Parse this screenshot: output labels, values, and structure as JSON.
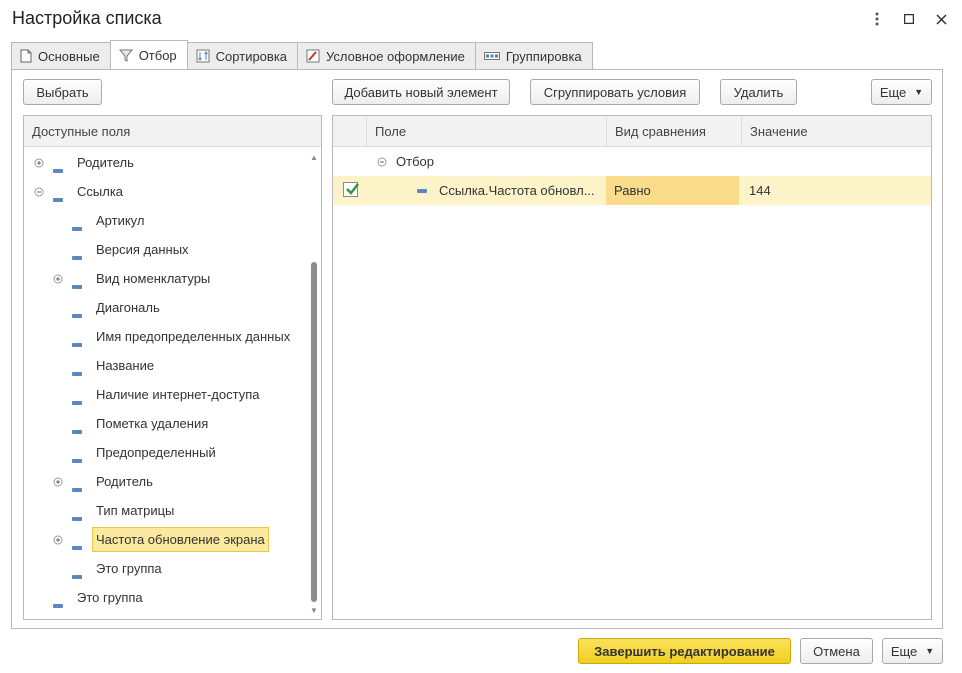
{
  "window": {
    "title": "Настройка списка"
  },
  "tabs": [
    {
      "label": "Основные",
      "icon": "document-icon"
    },
    {
      "label": "Отбор",
      "icon": "filter-icon",
      "active": true
    },
    {
      "label": "Сортировка",
      "icon": "sort-icon"
    },
    {
      "label": "Условное оформление",
      "icon": "paint-icon"
    },
    {
      "label": "Группировка",
      "icon": "grouping-icon"
    }
  ],
  "left": {
    "select_button": "Выбрать",
    "header": "Доступные поля",
    "items": [
      {
        "label": "Родитель",
        "level": 0,
        "expandable": true
      },
      {
        "label": "Ссылка",
        "level": 0,
        "expanded": true
      },
      {
        "label": "Артикул",
        "level": 1
      },
      {
        "label": "Версия данных",
        "level": 1
      },
      {
        "label": "Вид номенклатуры",
        "level": 1,
        "expandable": true
      },
      {
        "label": "Диагональ",
        "level": 1
      },
      {
        "label": "Имя предопределенных данных",
        "level": 1
      },
      {
        "label": "Название",
        "level": 1
      },
      {
        "label": "Наличие интернет-доступа",
        "level": 1
      },
      {
        "label": "Пометка удаления",
        "level": 1
      },
      {
        "label": "Предопределенный",
        "level": 1
      },
      {
        "label": "Родитель",
        "level": 1,
        "expandable": true
      },
      {
        "label": "Тип матрицы",
        "level": 1
      },
      {
        "label": "Частота обновление экрана",
        "level": 1,
        "expandable": true,
        "selected": true
      },
      {
        "label": "Это группа",
        "level": 1
      },
      {
        "label": "Это группа",
        "level": 0
      }
    ]
  },
  "right": {
    "toolbar": {
      "add": "Добавить новый элемент",
      "group": "Сгруппировать условия",
      "delete": "Удалить",
      "more": "Еще"
    },
    "columns": {
      "field": "Поле",
      "comparison": "Вид сравнения",
      "value": "Значение"
    },
    "group_row": {
      "label": "Отбор"
    },
    "rows": [
      {
        "checked": true,
        "field": "Ссылка.Частота обновл...",
        "comparison": "Равно",
        "value": "144"
      }
    ]
  },
  "footer": {
    "finish": "Завершить редактирование",
    "cancel": "Отмена",
    "more": "Еще"
  },
  "colors": {
    "accent_yellow": "#f1cf1f",
    "highlight_row": "#fdf3c8",
    "selected_cell": "#f8dc8a",
    "checkbox_green": "#2e9a3e"
  }
}
